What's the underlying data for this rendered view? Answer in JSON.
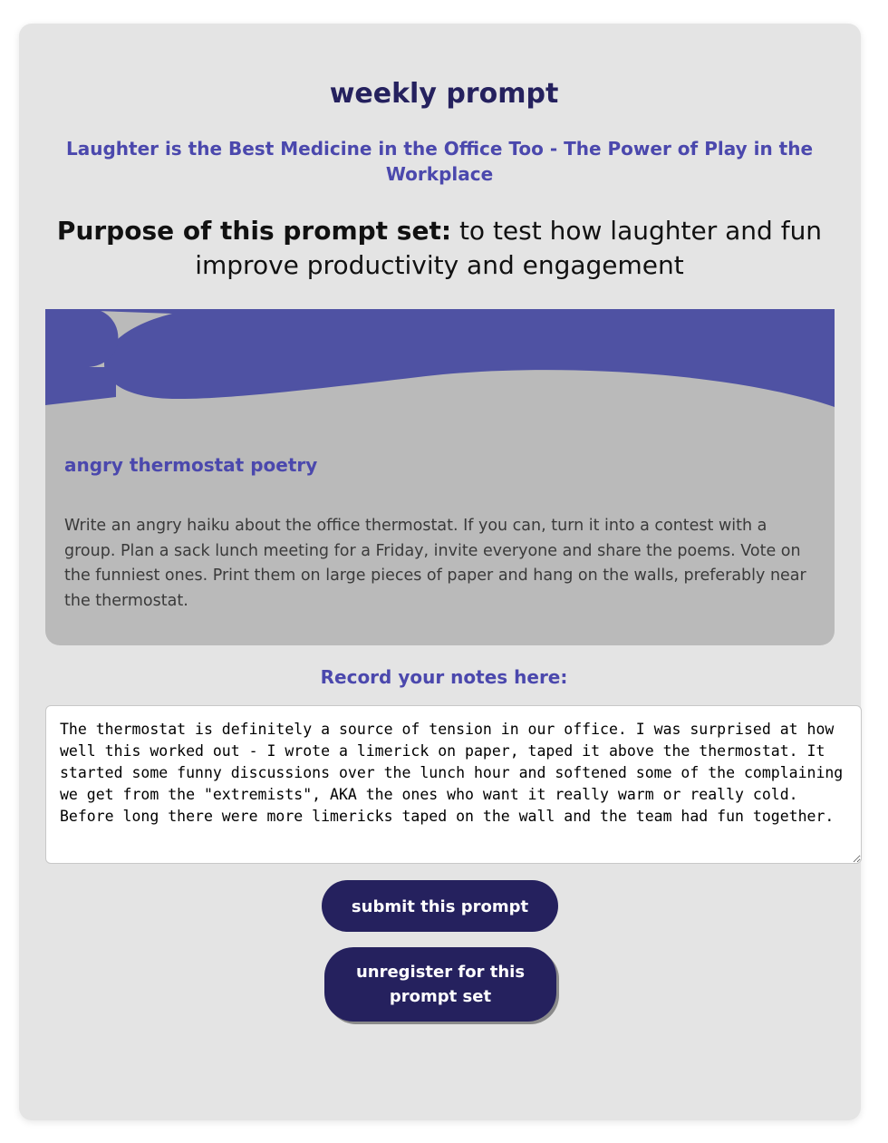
{
  "header": {
    "title": "weekly prompt",
    "subtitle": "Laughter is the Best Medicine in the Office Too - The Power of Play in the Workplace",
    "purpose_label": "Purpose of this prompt set:",
    "purpose_text": " to test how laughter and fun improve productivity and engagement"
  },
  "prompt_card": {
    "heading": "angry thermostat poetry",
    "body": "Write an angry haiku about the office thermostat. If you can, turn it into a contest with a group. Plan a sack lunch meeting for a Friday, invite everyone and share the poems. Vote on the funniest ones. Print them on large pieces of paper and hang on the walls, preferably near the thermostat."
  },
  "notes": {
    "label": "Record your notes here:",
    "value": "The thermostat is definitely a source of tension in our office. I was surprised at how well this worked out - I wrote a limerick on paper, taped it above the thermostat. It started some funny discussions over the lunch hour and softened some of the complaining we get from the \"extremists\", AKA the ones who want it really warm or really cold. Before long there were more limericks taped on the wall and the team had fun together."
  },
  "buttons": {
    "submit_label": "submit this prompt",
    "unregister_label": "unregister for this prompt set"
  },
  "colors": {
    "panel_bg": "#e4e4e4",
    "navy": "#25215e",
    "accent_purple": "#4b48ad",
    "wave_blue": "#4f52a3",
    "card_bg": "#bababa"
  }
}
